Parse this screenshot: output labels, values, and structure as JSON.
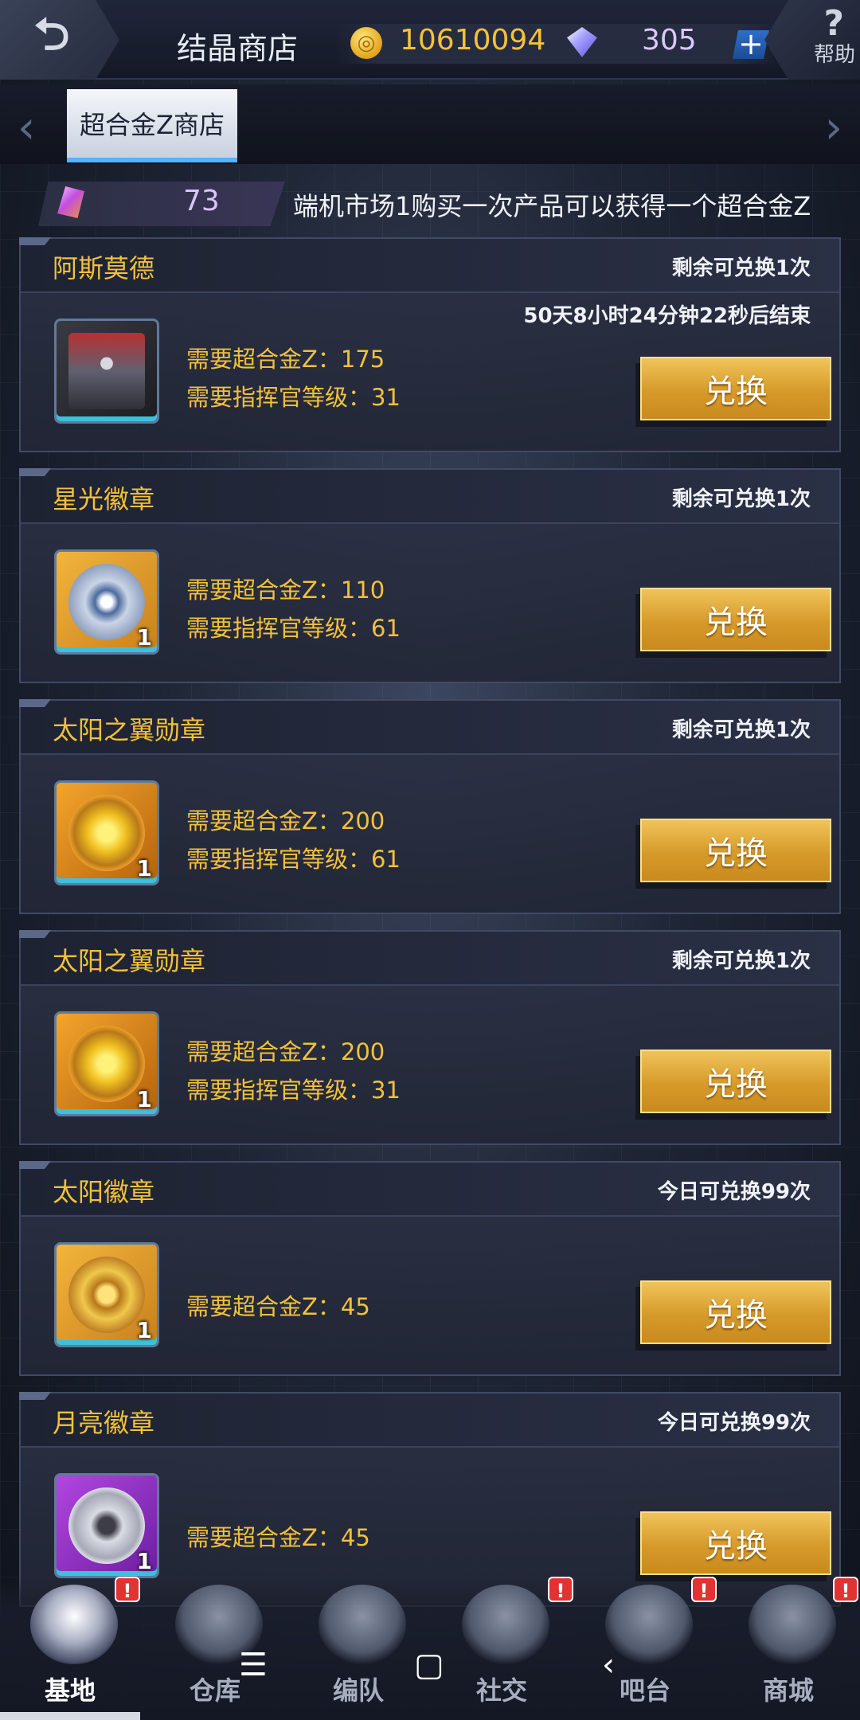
{
  "header": {
    "title": "结晶商店",
    "back_icon": "back-arrow-icon",
    "coins": "10610094",
    "diamonds": "305",
    "plus_label": "+",
    "help_label": "帮助"
  },
  "tabs": {
    "active_label": "超合金Z商店"
  },
  "promo": {
    "currency_count": "73",
    "marquee_text": "端机市场1购买一次产品可以获得一个超合金Z"
  },
  "items": [
    {
      "name": "阿斯莫德",
      "limit": "剩余可兑换1次",
      "timer": "50天8小时24分钟22秒后结束",
      "req_alloy": "需要超合金Z：175",
      "req_level": "需要指挥官等级：31",
      "qty": "",
      "button": "兑换"
    },
    {
      "name": "星光徽章",
      "limit": "剩余可兑换1次",
      "req_alloy": "需要超合金Z：110",
      "req_level": "需要指挥官等级：61",
      "qty": "1",
      "button": "兑换"
    },
    {
      "name": "太阳之翼勋章",
      "limit": "剩余可兑换1次",
      "req_alloy": "需要超合金Z：200",
      "req_level": "需要指挥官等级：61",
      "qty": "1",
      "button": "兑换"
    },
    {
      "name": "太阳之翼勋章",
      "limit": "剩余可兑换1次",
      "req_alloy": "需要超合金Z：200",
      "req_level": "需要指挥官等级：31",
      "qty": "1",
      "button": "兑换"
    },
    {
      "name": "太阳徽章",
      "limit": "今日可兑换99次",
      "req_alloy": "需要超合金Z：45",
      "qty": "1",
      "button": "兑换"
    },
    {
      "name": "月亮徽章",
      "limit": "今日可兑换99次",
      "req_alloy": "需要超合金Z：45",
      "qty": "1",
      "button": "兑换"
    }
  ],
  "nav": [
    {
      "label": "基地",
      "badge": "!",
      "icon": "base-icon"
    },
    {
      "label": "仓库",
      "badge": "",
      "icon": "warehouse-icon"
    },
    {
      "label": "编队",
      "badge": "",
      "icon": "formation-icon"
    },
    {
      "label": "社交",
      "badge": "!",
      "icon": "handshake-icon"
    },
    {
      "label": "吧台",
      "badge": "!",
      "icon": "bar-icon"
    },
    {
      "label": "商城",
      "badge": "!",
      "icon": "mall-icon"
    }
  ],
  "system_bar": {
    "menu": "☰",
    "home": "▢",
    "back": "‹"
  }
}
